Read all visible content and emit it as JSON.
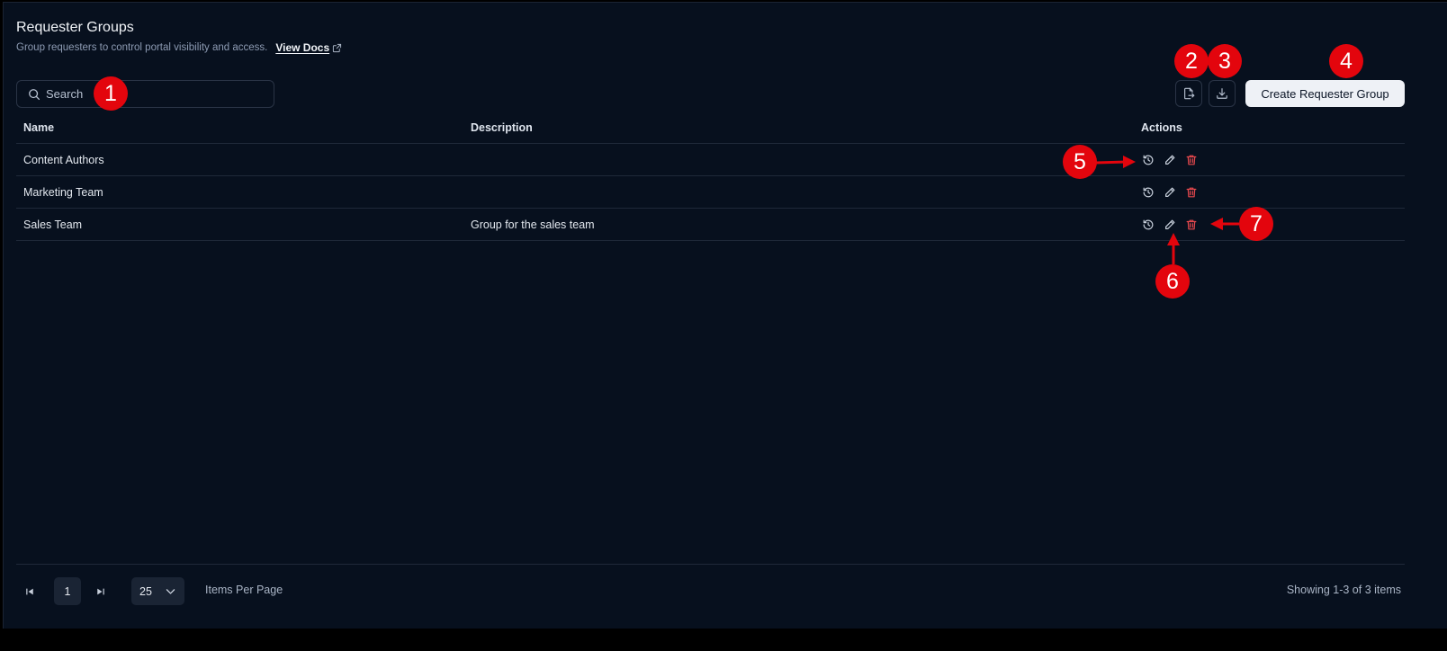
{
  "header": {
    "title": "Requester Groups",
    "subtitle": "Group requesters to control portal visibility and access.",
    "docs_link": "View Docs"
  },
  "search": {
    "placeholder": "Search"
  },
  "toolbar": {
    "export_icon": "file-export-icon",
    "download_icon": "download-icon",
    "create_label": "Create Requester Group",
    "create_bg": "#eef1f6"
  },
  "table": {
    "columns": [
      "Name",
      "Description",
      "Actions"
    ],
    "rows": [
      {
        "name": "Content Authors",
        "description": ""
      },
      {
        "name": "Marketing Team",
        "description": ""
      },
      {
        "name": "Sales Team",
        "description": "Group for the sales team"
      }
    ],
    "action_icons": [
      "history-icon",
      "pencil-icon",
      "trash-icon"
    ],
    "delete_color": "#e5484d"
  },
  "pagination": {
    "current_page": "1",
    "per_page": "25",
    "per_page_label": "Items Per Page",
    "summary": "Showing 1-3 of 3 items"
  },
  "annotations": {
    "color": "#e3050d",
    "badges": [
      "1",
      "2",
      "3",
      "4",
      "5",
      "6",
      "7"
    ]
  },
  "colors": {
    "background": "#07101e",
    "border": "#2a3446",
    "text": "#e6eaf0"
  }
}
